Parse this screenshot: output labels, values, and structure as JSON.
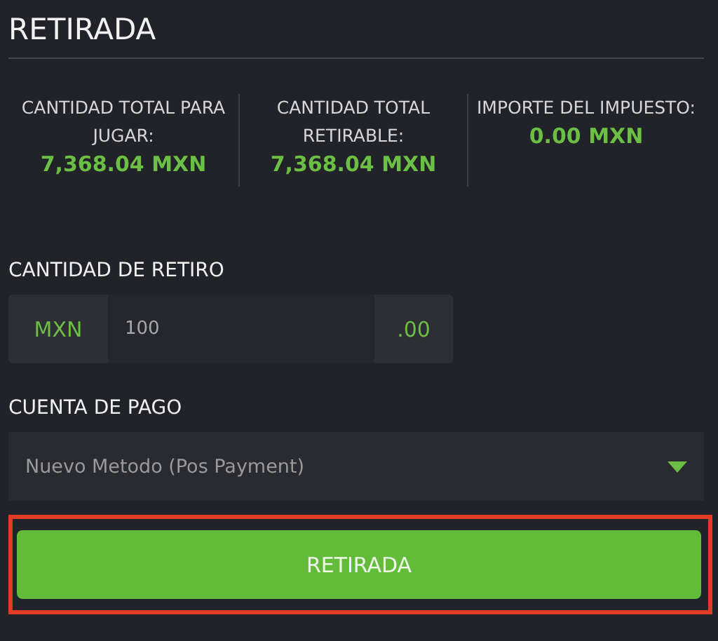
{
  "title": "RETIRADA",
  "stats": [
    {
      "label": "CANTIDAD TOTAL PARA JUGAR:",
      "value": "7,368.04 MXN"
    },
    {
      "label": "CANTIDAD TOTAL RETIRABLE:",
      "value": "7,368.04 MXN"
    },
    {
      "label": "IMPORTE DEL IMPUESTO:",
      "value": "0.00 MXN"
    }
  ],
  "amount": {
    "label": "CANTIDAD DE RETIRO",
    "currency": "MXN",
    "value": "100",
    "decimals": ".00"
  },
  "payment_account": {
    "label": "CUENTA DE PAGO",
    "value": "Nuevo Metodo (Pos Payment)"
  },
  "submit": {
    "label": "RETIRADA",
    "highlighted": true
  }
}
